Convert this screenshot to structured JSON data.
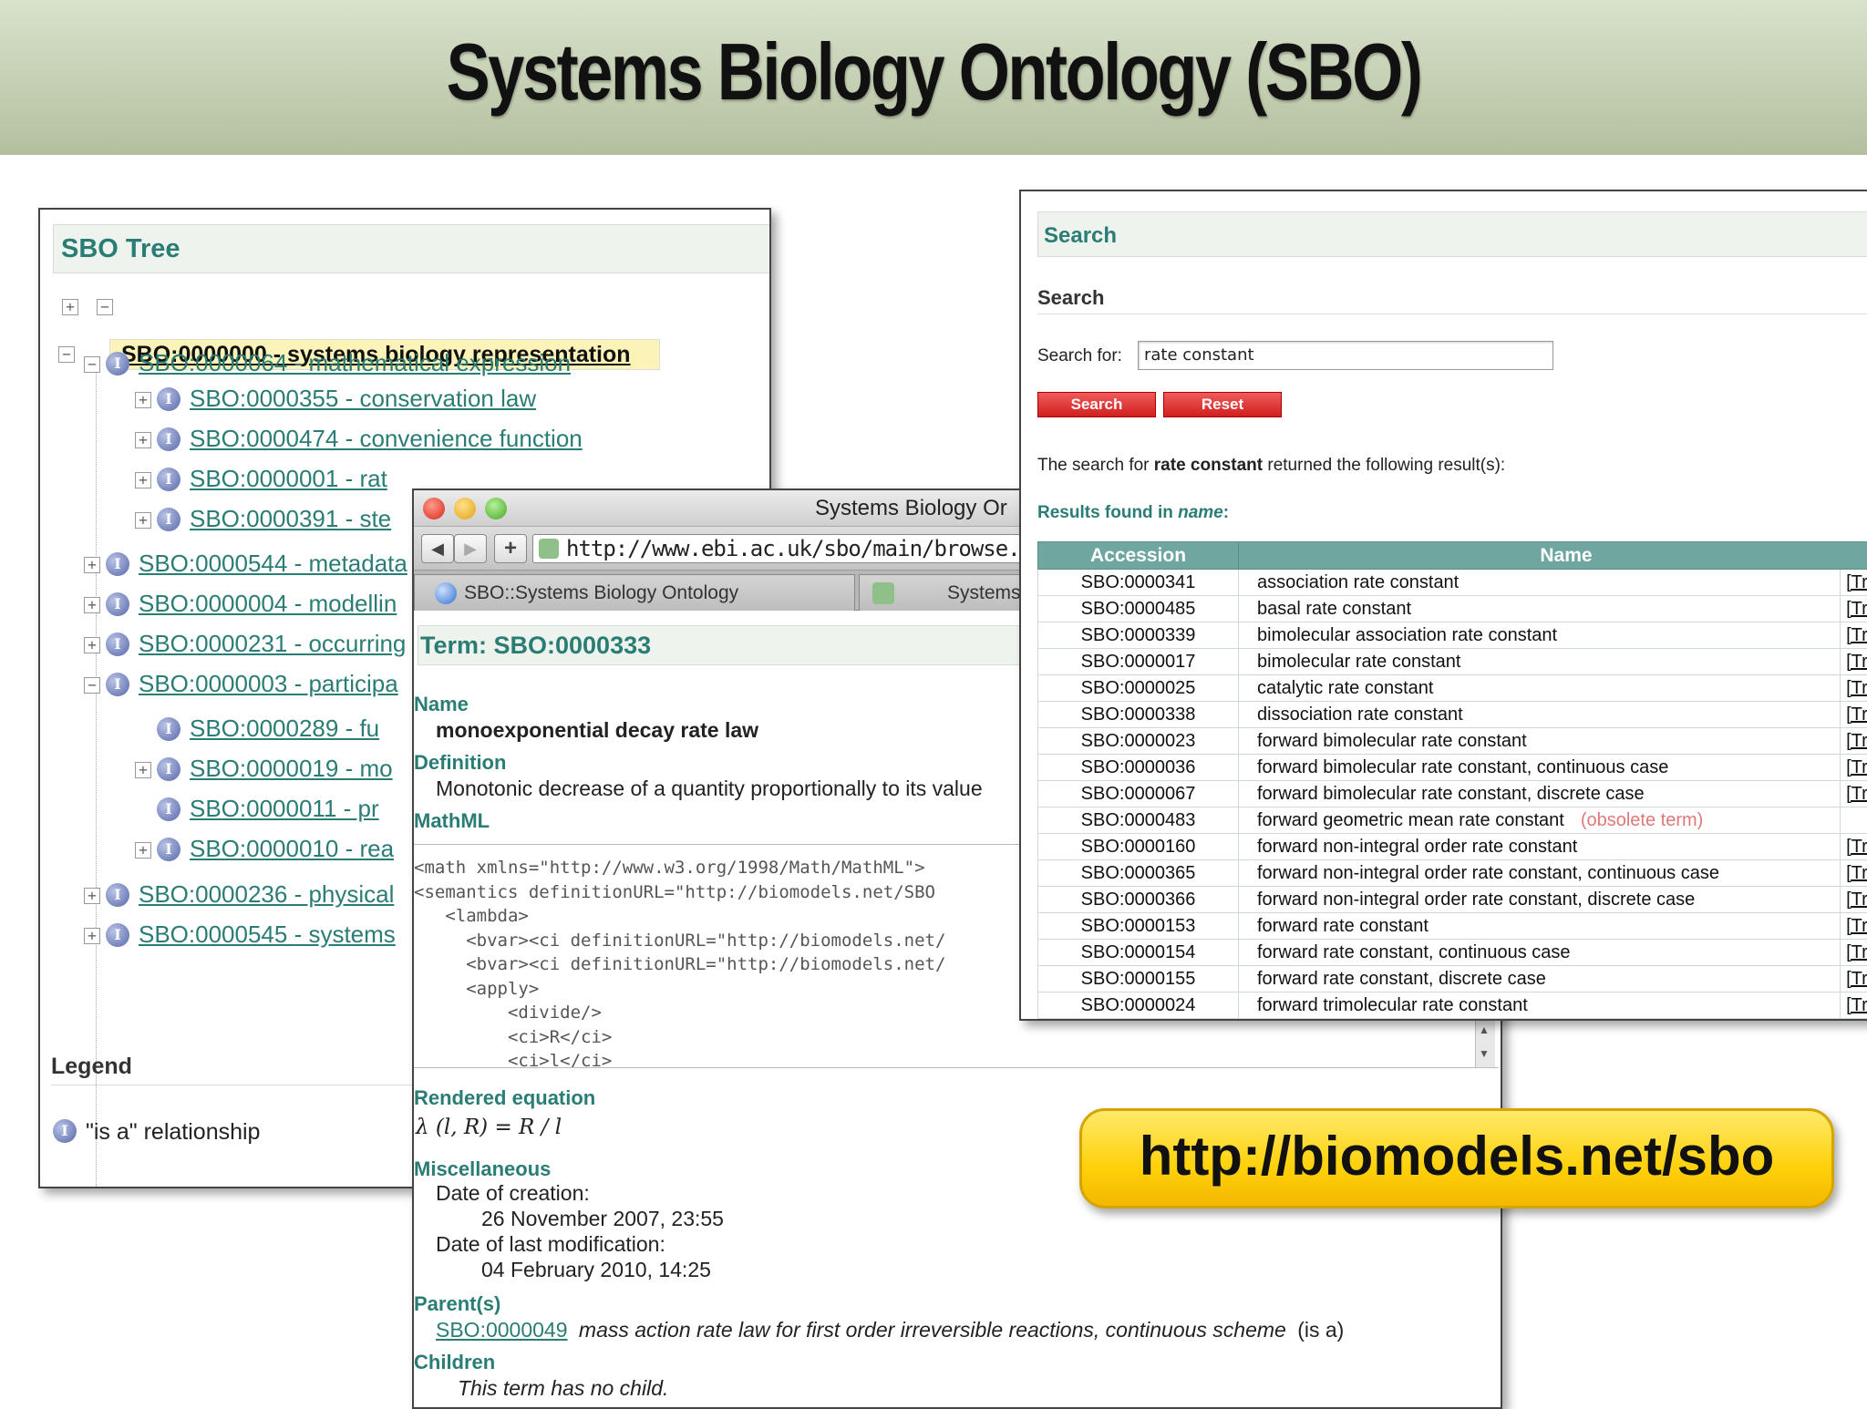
{
  "slide": {
    "title": "Systems Biology Ontology (SBO)",
    "url_badge": "http://biomodels.net/sbo"
  },
  "tree": {
    "panel_title": "SBO Tree",
    "expand_all": "+",
    "collapse_all": "−",
    "root": "SBO:0000000 - systems biology representation",
    "items": [
      {
        "label": "SBO:0000064 - mathematical expression",
        "toggle": "−"
      },
      {
        "label": "SBO:0000355 - conservation law",
        "toggle": "+"
      },
      {
        "label": "SBO:0000474 - convenience function",
        "toggle": "+"
      },
      {
        "label": "SBO:0000001 - rat",
        "toggle": "+"
      },
      {
        "label": "SBO:0000391 - ste",
        "toggle": "+"
      },
      {
        "label": "SBO:0000544 - metadata",
        "toggle": "+"
      },
      {
        "label": "SBO:0000004 - modellin",
        "toggle": "+"
      },
      {
        "label": "SBO:0000231 - occurring",
        "toggle": "+"
      },
      {
        "label": "SBO:0000003 - participa",
        "toggle": "−"
      },
      {
        "label": "SBO:0000289 - fu",
        "toggle": ""
      },
      {
        "label": "SBO:0000019 - mo",
        "toggle": "+"
      },
      {
        "label": "SBO:0000011 - pr",
        "toggle": ""
      },
      {
        "label": "SBO:0000010 - rea",
        "toggle": "+"
      },
      {
        "label": "SBO:0000236 - physical",
        "toggle": "+"
      },
      {
        "label": "SBO:0000545 - systems",
        "toggle": "+"
      }
    ],
    "legend_title": "Legend",
    "legend_item": "\"is a\" relationship",
    "icon_glyph": "I"
  },
  "browser": {
    "window_title": "Systems Biology Or",
    "url": "http://www.ebi.ac.uk/sbo/main/browse.",
    "tabs": [
      "SBO::Systems Biology Ontology",
      "Systems"
    ],
    "back": "◀",
    "forward": "▶",
    "new_tab": "+"
  },
  "term": {
    "heading": "Term: SBO:0000333",
    "name_label": "Name",
    "name": "monoexponential decay rate law",
    "definition_label": "Definition",
    "definition": "Monotonic decrease of a quantity proportionally to its value",
    "mathml_label": "MathML",
    "mathml_code": "<math xmlns=\"http://www.w3.org/1998/Math/MathML\">\n<semantics definitionURL=\"http://biomodels.net/SBO\n   <lambda>\n     <bvar><ci definitionURL=\"http://biomodels.net/\n     <bvar><ci definitionURL=\"http://biomodels.net/\n     <apply>\n         <divide/>\n         <ci>R</ci>\n         <ci>l</ci>",
    "rendered_label": "Rendered equation",
    "rendered_eq": "λ (l, R) = R / l",
    "misc_label": "Miscellaneous",
    "created_label": "Date of creation:",
    "created": "26 November 2007, 23:55",
    "modified_label": "Date of last modification:",
    "modified": "04 February 2010, 14:25",
    "parents_label": "Parent(s)",
    "parent_id": "SBO:0000049",
    "parent_desc": "mass action rate law for first order irreversible reactions, continuous scheme",
    "parent_rel": "(is a)",
    "children_label": "Children",
    "children": "This term has no child."
  },
  "search": {
    "panel_title": "Search",
    "section_title": "Search",
    "for_label": "Search for:",
    "query": "rate constant",
    "search_button": "Search",
    "reset_button": "Reset",
    "msg_pre": "The search for ",
    "msg_term": "rate constant",
    "msg_post": " returned the following result(s):",
    "found_pre": "Results found in ",
    "found_field": "name",
    "found_post": ":",
    "columns": [
      "Accession",
      "Name"
    ],
    "tree_link": "[Tree",
    "rows": [
      {
        "acc": "SBO:0000341",
        "name": "association rate constant",
        "obsolete": ""
      },
      {
        "acc": "SBO:0000485",
        "name": "basal rate constant",
        "obsolete": ""
      },
      {
        "acc": "SBO:0000339",
        "name": "bimolecular association rate constant",
        "obsolete": ""
      },
      {
        "acc": "SBO:0000017",
        "name": "bimolecular rate constant",
        "obsolete": ""
      },
      {
        "acc": "SBO:0000025",
        "name": "catalytic rate constant",
        "obsolete": ""
      },
      {
        "acc": "SBO:0000338",
        "name": "dissociation rate constant",
        "obsolete": ""
      },
      {
        "acc": "SBO:0000023",
        "name": "forward bimolecular rate constant",
        "obsolete": ""
      },
      {
        "acc": "SBO:0000036",
        "name": "forward bimolecular rate constant, continuous case",
        "obsolete": ""
      },
      {
        "acc": "SBO:0000067",
        "name": "forward bimolecular rate constant, discrete case",
        "obsolete": ""
      },
      {
        "acc": "SBO:0000483",
        "name": "forward geometric mean rate constant",
        "obsolete": "(obsolete term)"
      },
      {
        "acc": "SBO:0000160",
        "name": "forward non-integral order rate constant",
        "obsolete": ""
      },
      {
        "acc": "SBO:0000365",
        "name": "forward non-integral order rate constant, continuous case",
        "obsolete": ""
      },
      {
        "acc": "SBO:0000366",
        "name": "forward non-integral order rate constant, discrete case",
        "obsolete": ""
      },
      {
        "acc": "SBO:0000153",
        "name": "forward rate constant",
        "obsolete": ""
      },
      {
        "acc": "SBO:0000154",
        "name": "forward rate constant, continuous case",
        "obsolete": ""
      },
      {
        "acc": "SBO:0000155",
        "name": "forward rate constant, discrete case",
        "obsolete": ""
      },
      {
        "acc": "SBO:0000024",
        "name": "forward trimolecular rate constant",
        "obsolete": ""
      }
    ]
  },
  "colors": {
    "teal": "#2a7d74",
    "table_header": "#6fa69f",
    "button_red": "#d21f1f",
    "badge_yellow": "#ffd10a"
  }
}
